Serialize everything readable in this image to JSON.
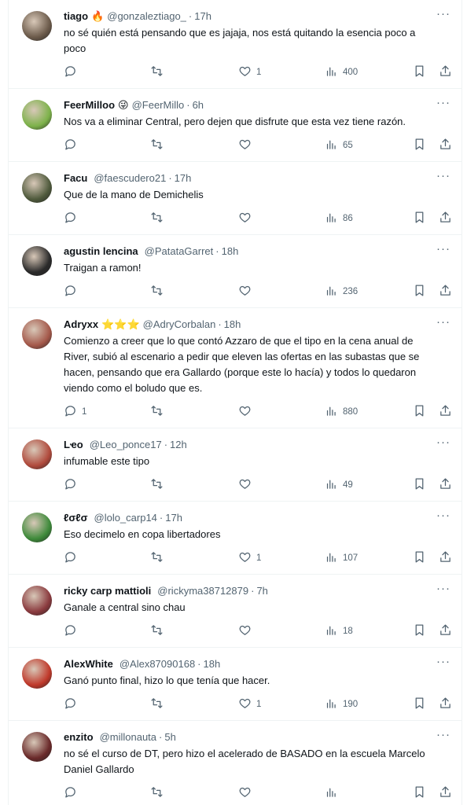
{
  "tweets": [
    {
      "name": "tiago",
      "badge": "🔥",
      "handle": "@gonzaleztiago_",
      "time": "17h",
      "text": "no sé quién está pensando que es jajaja, nos está quitando la esencia poco a poco",
      "replies": "",
      "retweets": "",
      "likes": "1",
      "views": "400",
      "avatar_color": "#6b5a4a"
    },
    {
      "name": "FeerMilloo",
      "badge": "😜",
      "handle": "@FeerMillo",
      "time": "6h",
      "text": "Nos va a eliminar Central, pero dejen que disfrute que esta vez tiene razón.",
      "replies": "",
      "retweets": "",
      "likes": "",
      "views": "65",
      "avatar_color": "#7db24a"
    },
    {
      "name": "Facu",
      "badge": "",
      "handle": "@faescudero21",
      "time": "17h",
      "text": "Que de la mano de Demichelis",
      "replies": "",
      "retweets": "",
      "likes": "",
      "views": "86",
      "avatar_color": "#4f5a3c"
    },
    {
      "name": "agustin lencina",
      "badge": "",
      "handle": "@PatataGarret",
      "time": "18h",
      "text": "Traigan a ramon!",
      "replies": "",
      "retweets": "",
      "likes": "",
      "views": "236",
      "avatar_color": "#2a2a2a"
    },
    {
      "name": "Adryxx",
      "badge": "⭐⭐⭐",
      "handle": "@AdryCorbalan",
      "time": "18h",
      "text": "Comienzo a creer que lo que contó Azzaro de que el tipo en la cena anual de River, subió al escenario a pedir que eleven las ofertas en las subastas que se hacen, pensando que era Gallardo (porque este lo hacía) y todos lo quedaron viendo como el boludo que es.",
      "replies": "1",
      "retweets": "",
      "likes": "",
      "views": "880",
      "avatar_color": "#a4584a"
    },
    {
      "name": "Lҽo",
      "badge": "",
      "handle": "@Leo_ponce17",
      "time": "12h",
      "text": "infumable este tipo",
      "replies": "",
      "retweets": "",
      "likes": "",
      "views": "49",
      "avatar_color": "#b04a3c"
    },
    {
      "name": "ℓσℓσ",
      "badge": "",
      "handle": "@lolo_carp14",
      "time": "17h",
      "text": "Eso decimelo en copa libertadores",
      "replies": "",
      "retweets": "",
      "likes": "1",
      "views": "107",
      "avatar_color": "#3e8a3a"
    },
    {
      "name": "ricky carp mattioli",
      "badge": "",
      "handle": "@rickyma38712879",
      "time": "7h",
      "text": "Ganale a central sino chau",
      "replies": "",
      "retweets": "",
      "likes": "",
      "views": "18",
      "avatar_color": "#8a3a3e"
    },
    {
      "name": "AlexWhite",
      "badge": "",
      "handle": "@Alex87090168",
      "time": "18h",
      "text": "Ganó punto final, hizo lo que tenía que hacer.",
      "replies": "",
      "retweets": "",
      "likes": "1",
      "views": "190",
      "avatar_color": "#c0392b"
    },
    {
      "name": "enzito",
      "badge": "",
      "handle": "@millonauta",
      "time": "5h",
      "text": "no sé el curso de DT, pero hizo el acelerado de BASADO en la escuela Marcelo Daniel Gallardo",
      "replies": "",
      "retweets": "",
      "likes": "",
      "views": "",
      "avatar_color": "#6a2a2a"
    }
  ],
  "icons": {
    "reply": "reply-icon",
    "retweet": "retweet-icon",
    "like": "heart-icon",
    "views": "views-icon",
    "bookmark": "bookmark-icon",
    "share": "share-icon",
    "more": "more-icon"
  },
  "more_label": "···",
  "separator": "·"
}
